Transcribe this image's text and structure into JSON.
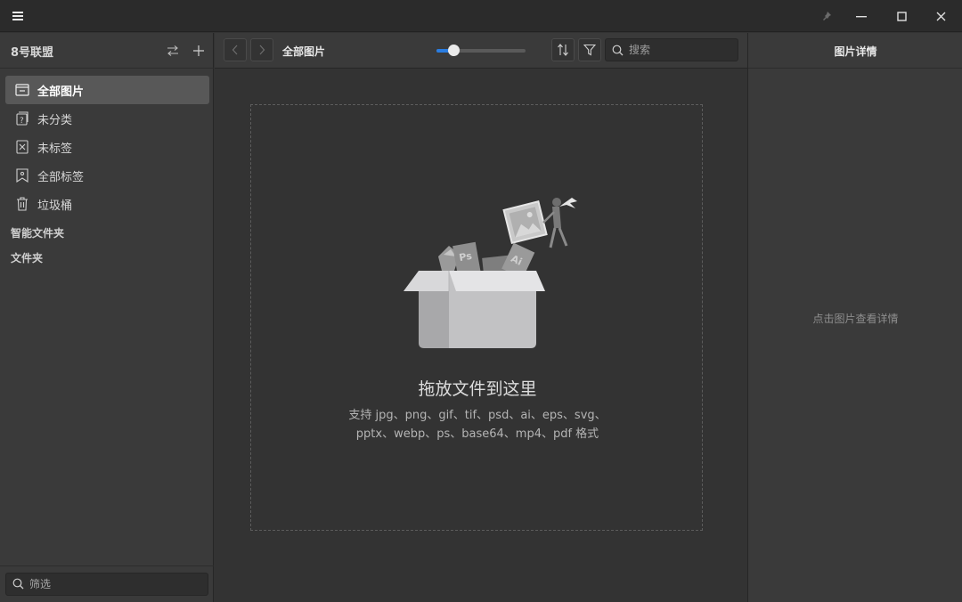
{
  "window": {
    "menu_icon": "hamburger-icon",
    "controls": [
      "pin-icon",
      "minimize-icon",
      "maximize-icon",
      "close-icon"
    ]
  },
  "sidebar": {
    "library_name": "8号联盟",
    "items": [
      {
        "label": "全部图片",
        "icon": "all-images-icon",
        "active": true
      },
      {
        "label": "未分类",
        "icon": "uncategorized-icon",
        "active": false
      },
      {
        "label": "未标签",
        "icon": "untagged-icon",
        "active": false
      },
      {
        "label": "全部标签",
        "icon": "all-tags-icon",
        "active": false
      },
      {
        "label": "垃圾桶",
        "icon": "trash-icon",
        "active": false
      }
    ],
    "sections": [
      "智能文件夹",
      "文件夹"
    ],
    "filter_placeholder": "筛选"
  },
  "toolbar": {
    "title": "全部图片",
    "zoom_level": 0.19,
    "search_placeholder": "搜索"
  },
  "dropzone": {
    "title": "拖放文件到这里",
    "formats_line1": "支持 jpg、png、gif、tif、psd、ai、eps、svg、",
    "formats_line2": "pptx、webp、ps、base64、mp4、pdf 格式"
  },
  "details": {
    "title": "图片详情",
    "empty_hint": "点击图片查看详情"
  },
  "colors": {
    "accent": "#2a7de1",
    "panel": "#3a3a3a",
    "background": "#333333"
  }
}
